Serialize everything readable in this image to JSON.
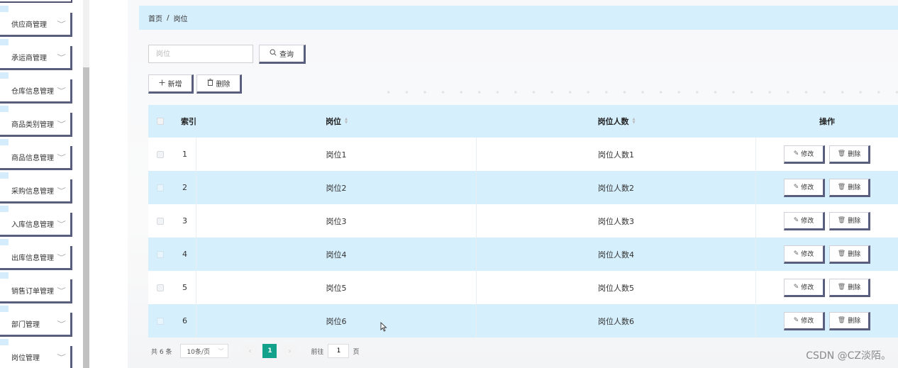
{
  "sidebar": {
    "items": [
      {
        "label": "供应商管理"
      },
      {
        "label": "承运商管理"
      },
      {
        "label": "仓库信息管理"
      },
      {
        "label": "商品类别管理"
      },
      {
        "label": "商品信息管理"
      },
      {
        "label": "采购信息管理"
      },
      {
        "label": "入库信息管理"
      },
      {
        "label": "出库信息管理"
      },
      {
        "label": "销售订单管理"
      },
      {
        "label": "部门管理"
      },
      {
        "label": "岗位管理"
      }
    ],
    "chevron": "﹀"
  },
  "breadcrumb": {
    "home": "首页",
    "sep": "/",
    "current": "岗位"
  },
  "search": {
    "placeholder": "岗位",
    "value": "",
    "button_label": "查询"
  },
  "toolbar": {
    "add_label": "新增",
    "delete_label": "删除"
  },
  "table": {
    "headers": {
      "index": "索引",
      "position": "岗位",
      "count": "岗位人数",
      "actions": "操作"
    },
    "edit_label": "修改",
    "delete_label": "删除",
    "rows": [
      {
        "index": "1",
        "position": "岗位1",
        "count": "岗位人数1"
      },
      {
        "index": "2",
        "position": "岗位2",
        "count": "岗位人数2"
      },
      {
        "index": "3",
        "position": "岗位3",
        "count": "岗位人数3"
      },
      {
        "index": "4",
        "position": "岗位4",
        "count": "岗位人数4"
      },
      {
        "index": "5",
        "position": "岗位5",
        "count": "岗位人数5"
      },
      {
        "index": "6",
        "position": "岗位6",
        "count": "岗位人数6"
      }
    ]
  },
  "pagination": {
    "total": "共 6 条",
    "page_size": "10条/页",
    "current_page": "1",
    "goto_label": "前往",
    "goto_value": "1",
    "page_suffix": "页"
  },
  "watermark": "CSDN @CZ淡陌。"
}
